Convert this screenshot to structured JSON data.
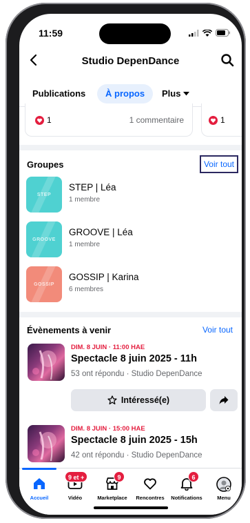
{
  "status_bar": {
    "time": "11:59"
  },
  "header": {
    "title": "Studio DepenDance",
    "back_icon": "chevron-left-icon",
    "search_icon": "search-icon"
  },
  "tabs": [
    {
      "label": "Publications"
    },
    {
      "label": "À propos",
      "active": true
    },
    {
      "label": "Plus"
    }
  ],
  "reaction_cards": [
    {
      "likes": "1",
      "comments": "1 commentaire"
    },
    {
      "likes": "1"
    }
  ],
  "groups": {
    "title": "Groupes",
    "see_all": "Voir tout",
    "items": [
      {
        "name": "STEP | Léa",
        "members": "1 membre",
        "thumb_text": "STEP",
        "color": "#4fd1d1"
      },
      {
        "name": "GROOVE | Léa",
        "members": "1 membre",
        "thumb_text": "GROOVE",
        "color": "#4fd1d1"
      },
      {
        "name": "GOSSIP | Karina",
        "members": "6 membres",
        "thumb_text": "GOSSIP",
        "color": "#f28b7a"
      }
    ]
  },
  "events": {
    "title": "Évènements à venir",
    "see_all": "Voir tout",
    "items": [
      {
        "date": "DIM. 8 JUIN · 11:00 HAE",
        "title": "Spectacle 8 juin 2025 - 11h",
        "meta": "53 ont répondu · Studio DepenDance",
        "interest_label": "Intéressé(e)"
      },
      {
        "date": "DIM. 8 JUIN · 15:00 HAE",
        "title": "Spectacle 8 juin 2025 - 15h",
        "meta": "42 ont répondu · Studio DepenDance"
      }
    ]
  },
  "bottom_nav": [
    {
      "label": "Accueil",
      "icon": "home-icon",
      "active": true
    },
    {
      "label": "Vidéo",
      "icon": "video-icon",
      "badge": "9 et +"
    },
    {
      "label": "Marketplace",
      "icon": "marketplace-icon",
      "badge": "9"
    },
    {
      "label": "Rencontres",
      "icon": "heart-icon"
    },
    {
      "label": "Notifications",
      "icon": "bell-icon",
      "badge": "6"
    },
    {
      "label": "Menu",
      "icon": "avatar-icon"
    }
  ],
  "colors": {
    "accent": "#0866ff",
    "badge": "#e41e3f",
    "text": "#050505",
    "secondary": "#65676b"
  }
}
